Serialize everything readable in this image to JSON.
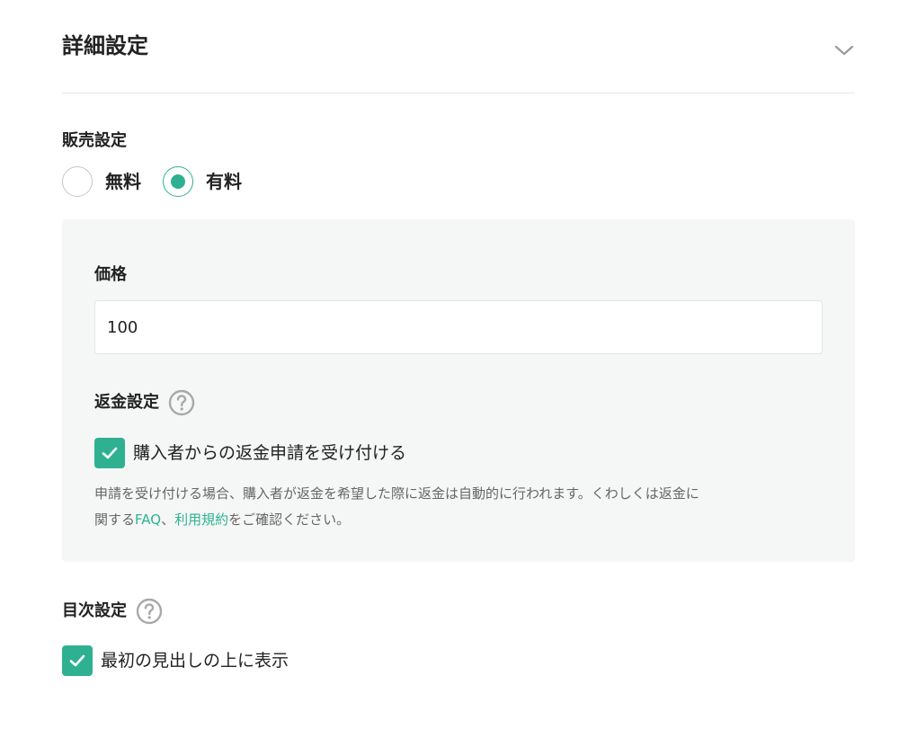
{
  "header": {
    "title": "詳細設定"
  },
  "sales": {
    "title": "販売設定",
    "options": [
      {
        "label": "無料",
        "selected": false
      },
      {
        "label": "有料",
        "selected": true
      }
    ]
  },
  "price": {
    "label": "価格",
    "value": "100"
  },
  "refund": {
    "title": "返金設定",
    "checkbox_label": "購入者からの返金申請を受け付ける",
    "checked": true,
    "note_line1": "申請を受け付ける場合、購入者が返金を希望した際に返金は自動的に行われます。くわしくは返金に",
    "note_prefix": "関する",
    "faq_link": "FAQ",
    "separator": "、",
    "terms_link": "利用規約",
    "note_suffix": "をご確認ください。"
  },
  "toc": {
    "title": "目次設定",
    "checkbox_label": "最初の見出しの上に表示",
    "checked": true
  },
  "colors": {
    "accent": "#2fb191",
    "panel_bg": "#f5f7f7",
    "help_icon": "#a8a8a8"
  },
  "icons": {
    "chevron": "chevron-down-icon",
    "help": "question-circle-icon",
    "check": "check-icon"
  }
}
